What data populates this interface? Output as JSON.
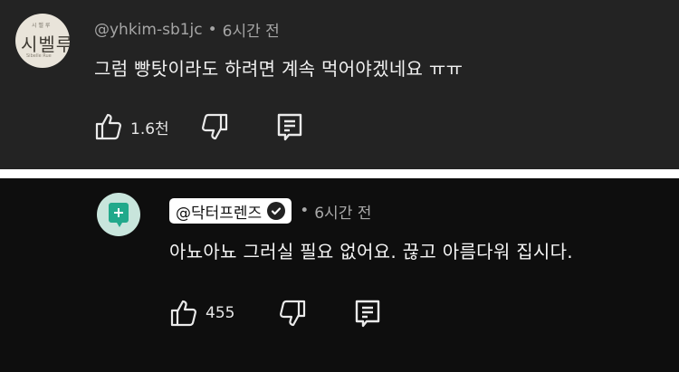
{
  "comments": [
    {
      "author": "@yhkim-sb1jc",
      "separator": "•",
      "time": "6시간 전",
      "text": "그럼 빵탓이라도 하려면 계속 먹어야겠네요 ㅠㅠ",
      "likes": "1.6천",
      "avatar": {
        "main": "시벨루",
        "small_top": "시 벨 루",
        "small_bottom": "Sibelle Rue"
      },
      "icons": {
        "like": "thumbs-up-icon",
        "dislike": "thumbs-down-icon",
        "reply": "reply-icon"
      }
    },
    {
      "author": "@닥터프렌즈",
      "separator": "•",
      "time": "6시간 전",
      "text": "아뇨아뇨 그러실 필요 없어요. 끊고 아름다워 집시다.",
      "likes": "455",
      "verified": true,
      "colors": {
        "avatar_bg": "#c8e5dc",
        "avatar_accent": "#21a98b"
      },
      "icons": {
        "avatar": "plus-chat-icon",
        "verified": "verified-check-icon",
        "like": "thumbs-up-icon",
        "dislike": "thumbs-down-icon",
        "reply": "reply-icon"
      }
    }
  ],
  "colors": {
    "panel_top": "#232323",
    "panel_bottom": "#0e0e0e",
    "divider": "#ffffff"
  }
}
